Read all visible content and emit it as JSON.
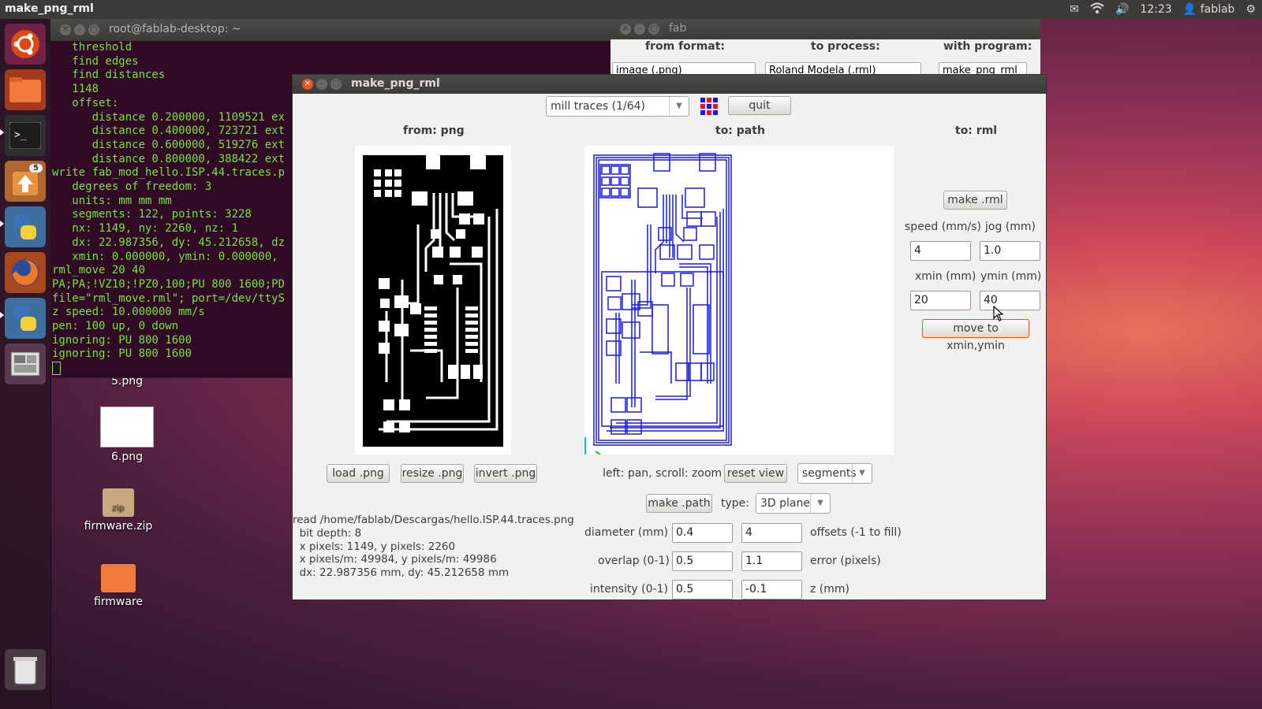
{
  "top_panel": {
    "app_title": "make_png_rml",
    "time": "12:23",
    "user": "fablab",
    "icons": [
      "mail-icon",
      "wifi-icon",
      "volume-icon",
      "user-icon",
      "gear-icon"
    ]
  },
  "launcher": {
    "items": [
      {
        "name": "ubuntu-home-icon"
      },
      {
        "name": "files-icon"
      },
      {
        "name": "terminal-icon"
      },
      {
        "name": "updates-icon",
        "badge": "5"
      },
      {
        "name": "python-icon"
      },
      {
        "name": "firefox-icon"
      },
      {
        "name": "python-icon"
      },
      {
        "name": "workspaces-icon"
      },
      {
        "name": "trash-icon"
      }
    ]
  },
  "desktop": {
    "icons": [
      {
        "label": "5.png"
      },
      {
        "label": "6.png"
      },
      {
        "label": "firmware.zip",
        "shape_text": "zip"
      },
      {
        "label": "firmware"
      }
    ]
  },
  "terminal": {
    "title": "root@fablab-desktop: ~",
    "lines": [
      "   threshold",
      "   find edges",
      "   find distances",
      "   1148",
      "   offset:",
      "      distance 0.200000, 1109521 ex",
      "      distance 0.400000, 723721 ext",
      "      distance 0.600000, 519276 ext",
      "      distance 0.800000, 388422 ext",
      "write fab_mod_hello.ISP.44.traces.p",
      "   degrees of freedom: 3",
      "   units: mm mm mm",
      "   segments: 122, points: 3228",
      "   nx: 1149, ny: 2260, nz: 1",
      "   dx: 22.987356, dy: 45.212658, dz",
      "   xmin: 0.000000, ymin: 0.000000,",
      "rml_move 20 40",
      "PA;PA;!VZ10;!PZ0,100;PU 800 1600;PD",
      "file=\"rml_move.rml\"; port=/dev/ttyS",
      "z speed: 10.000000 mm/s",
      "pen: 100 up, 0 down",
      "ignoring: PU 800 1600",
      "ignoring: PU 800 1600"
    ]
  },
  "fab": {
    "title": "fab",
    "from_format_label": "from format:",
    "to_process_label": "to process:",
    "with_program_label": "with program:",
    "from_format_value": "image (.png)",
    "to_process_value": "Roland Modela (.rml)",
    "with_program_value": "make_png_rml"
  },
  "main": {
    "title": "make_png_rml",
    "mode_select": "mill traces (1/64)",
    "quit_label": "quit",
    "from_png_header": "from: png",
    "to_path_header": "to: path",
    "to_rml_header": "to: rml",
    "load_png": "load .png",
    "resize_png": "resize .png",
    "invert_png": "invert .png",
    "pan_hint": "left: pan, scroll: zoom",
    "reset_view": "reset view",
    "view_select": "segments",
    "make_path": "make .path",
    "type_label": "type:",
    "type_select": "3D plane",
    "diameter_label": "diameter (mm)",
    "diameter_value": "0.4",
    "offsets_value": "4",
    "offsets_label": "offsets (-1 to fill)",
    "overlap_label": "overlap (0-1)",
    "overlap_value": "0.5",
    "error_value": "1.1",
    "error_label": "error (pixels)",
    "intensity_label": "intensity (0-1)",
    "intensity_value": "0.5",
    "z_value": "-0.1",
    "z_label": "z (mm)",
    "make_rml": "make .rml",
    "speed_label": "speed (mm/s)",
    "jog_label": "jog (mm)",
    "speed_value": "4",
    "jog_value": "1.0",
    "xmin_label": "xmin (mm)",
    "ymin_label": "ymin (mm)",
    "xmin_value": "20",
    "ymin_value": "40",
    "move_btn": "move to xmin,ymin",
    "info_lines": [
      "read /home/fablab/Descargas/hello.ISP.44.traces.png",
      "  bit depth: 8",
      "  x pixels: 1149, y pixels: 2260",
      "  x pixels/m: 49984, y pixels/m: 49986",
      "  dx: 22.987356 mm, dy: 45.212658 mm"
    ],
    "colors": {
      "path_blue": "#1a1adc",
      "accent": "#e95420"
    }
  }
}
